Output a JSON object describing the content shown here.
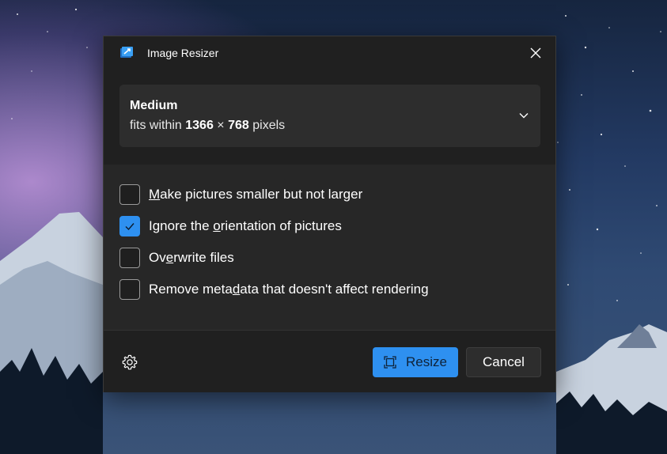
{
  "window": {
    "title": "Image Resizer",
    "icon": "image-resizer-app-icon",
    "close_icon": "close-icon"
  },
  "size": {
    "name": "Medium",
    "desc_prefix": "fits within",
    "width": "1366",
    "times": "×",
    "height": "768",
    "unit": "pixels",
    "dropdown_icon": "chevron-down-icon"
  },
  "options": [
    {
      "label_pre": "",
      "accel": "M",
      "label_post": "ake pictures smaller but not larger",
      "checked": false
    },
    {
      "label_pre": "Ignore the ",
      "accel": "o",
      "label_post": "rientation of pictures",
      "checked": true
    },
    {
      "label_pre": "Ov",
      "accel": "e",
      "label_post": "rwrite files",
      "checked": false
    },
    {
      "label_pre": "Remove meta",
      "accel": "d",
      "label_post": "ata that doesn't affect rendering",
      "checked": false
    }
  ],
  "footer": {
    "settings_icon": "gear-icon",
    "resize_label": "Resize",
    "resize_icon": "resize-icon",
    "cancel_label": "Cancel"
  },
  "colors": {
    "accent": "#2e90f0",
    "dialog_bg": "#202020",
    "options_bg": "#272727",
    "card_bg": "#2d2d2d"
  }
}
